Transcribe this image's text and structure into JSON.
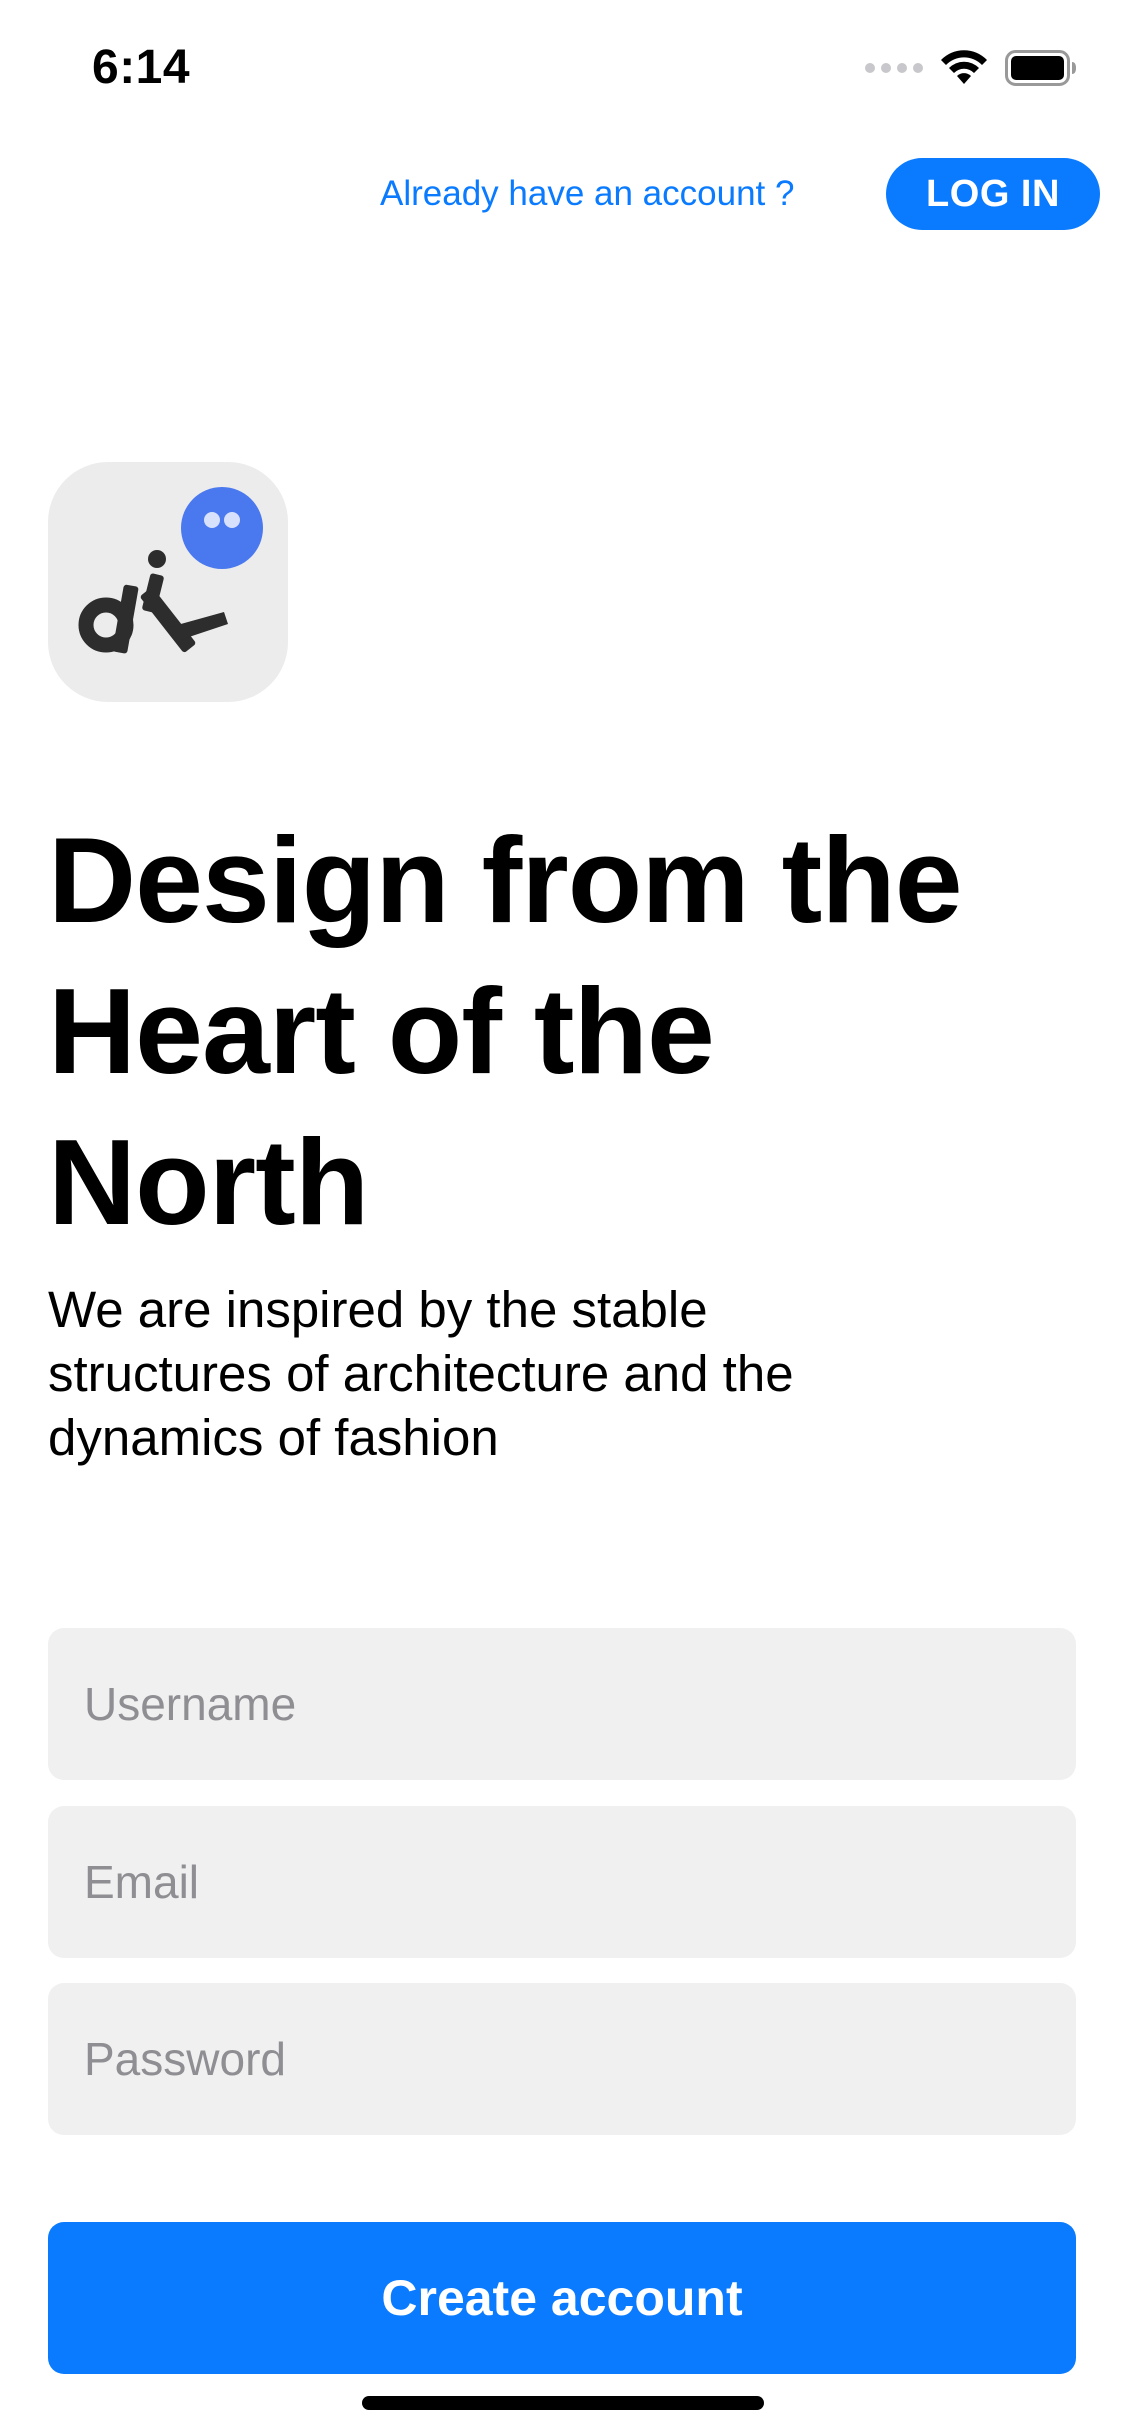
{
  "status_bar": {
    "time": "6:14",
    "icons": [
      "signal-icon",
      "wifi-icon",
      "battery-icon"
    ]
  },
  "header": {
    "already_text": "Already have an account ?",
    "login_label": "LOG IN"
  },
  "logo": {
    "name": "dik-logo",
    "text": "dik"
  },
  "hero": {
    "title": "Design from the Heart of the North",
    "subtitle": "We are inspired by the stable structures of architecture and the dynamics of fashion"
  },
  "form": {
    "username_placeholder": "Username",
    "username_value": "",
    "email_placeholder": "Email",
    "email_value": "",
    "password_placeholder": "Password",
    "password_value": "",
    "submit_label": "Create account"
  },
  "colors": {
    "accent": "#0a7bff",
    "field_background": "#f0f0f0",
    "placeholder": "#8e8e93",
    "logo_background": "#ececec",
    "logo_dot": "#4a78ee",
    "logo_glyph": "#2d2d2d"
  }
}
